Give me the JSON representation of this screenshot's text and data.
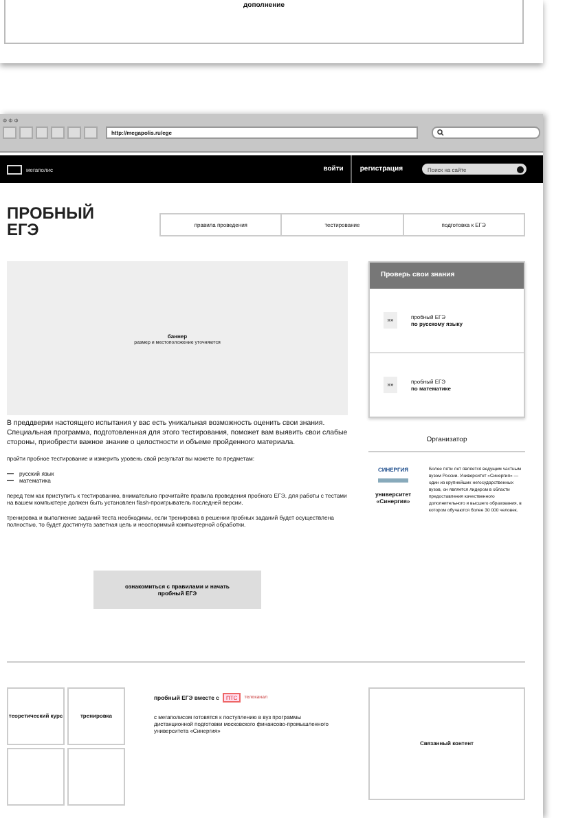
{
  "top_card": {
    "caption": "дополнение"
  },
  "browser": {
    "title": "Ф Ф Ф",
    "url": "http://megapolis.ru/ege"
  },
  "site_header": {
    "logo": "мегаполис",
    "links": [
      {
        "label": "войти"
      },
      {
        "label": "регистрация"
      }
    ],
    "search": {
      "placeholder": "Поиск на сайте"
    }
  },
  "page_title": "ПРОБНЫЙ ЕГЭ",
  "tabs": [
    {
      "label": "правила проведения",
      "selected": false
    },
    {
      "label": "тестирование",
      "selected": false
    },
    {
      "label": "подготовка к ЕГЭ",
      "selected": false
    }
  ],
  "banner": {
    "title": "баннер",
    "subtitle": "размер и местоположение уточняются"
  },
  "intro": "В преддверии настоящего испытания у вас есть уникальная возможность оценить свои знания. Специальная программа, подготовленная для этого тестирования, поможет вам выявить свои слабые стороны, приобрести важное знание о целостности и объеме пройденного материала.",
  "subjects_intro": "пройти пробное тестирование и измерить уровень свой результат вы можете по предметам:",
  "subjects": [
    "русский язык",
    "математика"
  ],
  "notes": [
    "перед тем как приступить к тестированию, внимательно прочитайте правила проведения пробного ЕГЭ. для работы с тестами на вашем компьютере должен быть установлен flash-проигрыватель последней версии.",
    "тренировка и выполнение заданий теста необходимы, если тренировка в решении пробных заданий будет осуществлена полностью, то будет достигнута заветная цель и неоспоримый компьютерной обработки."
  ],
  "start_button": "ознакомиться с правилами и начать пробный ЕГЭ",
  "sidebar": {
    "title": "Проверь свои знания",
    "items": [
      {
        "icon": "»»",
        "line1": "пробный ЕГЭ",
        "line2": "по русскому языку"
      },
      {
        "icon": "»»",
        "line1": "пробный ЕГЭ",
        "line2": "по математике"
      }
    ]
  },
  "organizer": {
    "title": "Организатор",
    "logo": "СИНЕРГИЯ",
    "name": "университет «Синергия»",
    "description": "Более пяти лет является ведущим частным вузом России. Университет «Синергия» — один из крупнейших негосударственных вузов, он является лидером в области предоставления качественного дополнительного и высшего образования, в котором обучаются более 30 000 человек."
  },
  "tiles": [
    "теоретический курс",
    "тренировка"
  ],
  "partner": {
    "heading": "пробный ЕГЭ вместе с",
    "badge": "ПТС",
    "badge_caption": "телеканал",
    "text": "с мегаполисом готовятся к поступлению в вуз программы дистанционной подготовки московского финансово-промышленного университета «Синергия»"
  },
  "related": "Связанный контент"
}
